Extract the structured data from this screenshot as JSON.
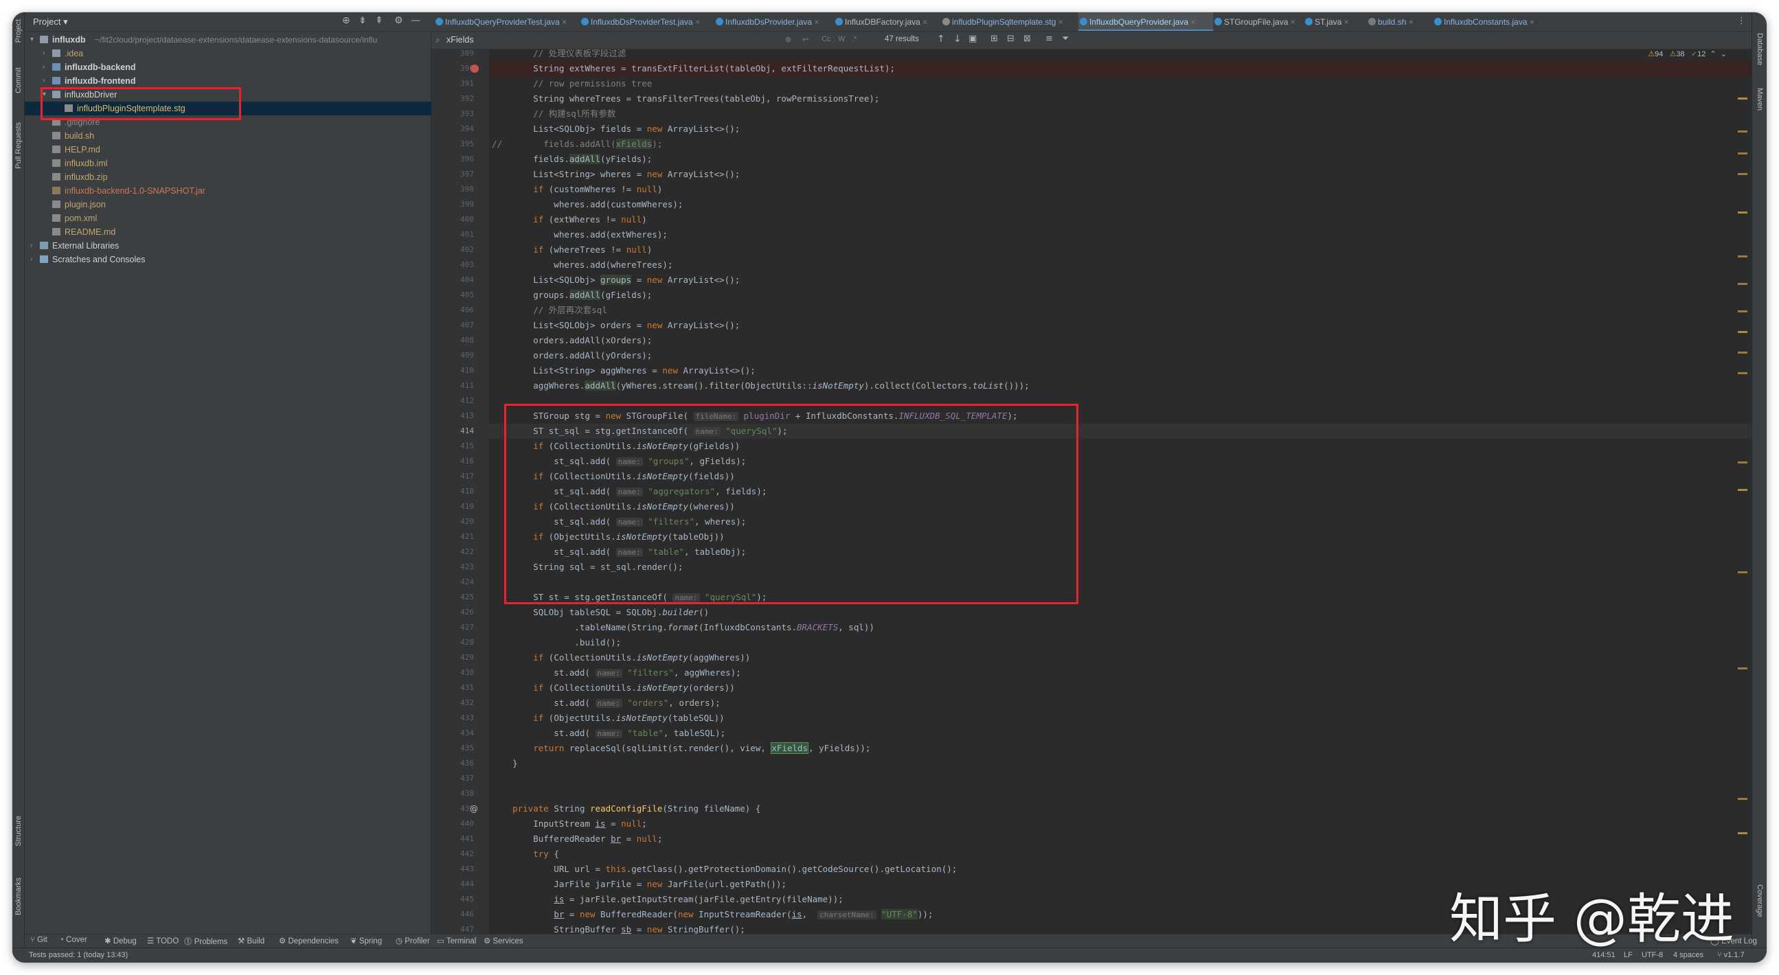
{
  "side_tools": {
    "left": [
      "Project",
      "Commit",
      "Pull Requests",
      "Structure",
      "Bookmarks"
    ],
    "right": [
      "Database",
      "Maven",
      "Coverage"
    ]
  },
  "project": {
    "title": "Project",
    "rows": [
      {
        "arrow": "▾",
        "label": "influxdb",
        "suffix": "~/fit2cloud/project/dataease-extensions/dataease-extensions-datasource/influ",
        "icon": "folder-icon",
        "color": "#d0d0d0",
        "bold": true,
        "indent": 0
      },
      {
        "arrow": "›",
        "label": ".idea",
        "icon": "folder-icon",
        "color": "#c5a66b",
        "indent": 1
      },
      {
        "arrow": "›",
        "label": "influxdb-backend",
        "icon": "module-folder-icon",
        "color": "#d0d0d0",
        "bold": true,
        "indent": 1
      },
      {
        "arrow": "›",
        "label": "influxdb-frontend",
        "icon": "module-folder-icon",
        "color": "#d0d0d0",
        "bold": true,
        "indent": 1
      },
      {
        "arrow": "▾",
        "label": "influxdbDriver",
        "icon": "folder-icon",
        "color": "#d0d0d0",
        "indent": 1
      },
      {
        "arrow": "",
        "label": "infludbPluginSqltemplate.stg",
        "icon": "file-icon",
        "color": "#d6bd6b",
        "indent": 2,
        "selected": true
      },
      {
        "arrow": "",
        "label": ".gitignore",
        "icon": "file-icon",
        "color": "#8a8a8a",
        "indent": 1
      },
      {
        "arrow": "",
        "label": "build.sh",
        "icon": "file-icon",
        "color": "#c5a66b",
        "indent": 1
      },
      {
        "arrow": "",
        "label": "HELP.md",
        "icon": "file-icon",
        "color": "#c5a66b",
        "indent": 1
      },
      {
        "arrow": "",
        "label": "influxdb.iml",
        "icon": "file-icon",
        "color": "#c5a66b",
        "indent": 1
      },
      {
        "arrow": "",
        "label": "influxdb.zip",
        "icon": "file-icon",
        "color": "#c5a66b",
        "indent": 1
      },
      {
        "arrow": "",
        "label": "influxdb-backend-1.0-SNAPSHOT.jar",
        "icon": "jar-icon",
        "color": "#d07852",
        "indent": 1
      },
      {
        "arrow": "",
        "label": "plugin.json",
        "icon": "file-icon",
        "color": "#c5a66b",
        "indent": 1
      },
      {
        "arrow": "",
        "label": "pom.xml",
        "icon": "file-icon",
        "color": "#c5a66b",
        "indent": 1
      },
      {
        "arrow": "",
        "label": "README.md",
        "icon": "file-icon",
        "color": "#c5a66b",
        "indent": 1
      },
      {
        "arrow": "›",
        "label": "External Libraries",
        "icon": "library-icon",
        "color": "#d0d0d0",
        "indent": 0
      },
      {
        "arrow": "›",
        "label": "Scratches and Consoles",
        "icon": "scratch-icon",
        "color": "#d0d0d0",
        "indent": 0
      }
    ]
  },
  "tabs": [
    {
      "label": "InfluxdbQueryProviderTest.java",
      "state": "mod"
    },
    {
      "label": "InfluxdbDsProviderTest.java",
      "state": "mod"
    },
    {
      "label": "InfluxdbDsProvider.java",
      "state": "mod"
    },
    {
      "label": "InfluxDBFactory.java",
      "state": ""
    },
    {
      "label": "infludbPluginSqltemplate.stg",
      "state": "mod"
    },
    {
      "label": "InfluxdbQueryProvider.java",
      "state": "active"
    },
    {
      "label": "STGroupFile.java",
      "state": ""
    },
    {
      "label": "ST.java",
      "state": ""
    },
    {
      "label": "build.sh",
      "state": "mod"
    },
    {
      "label": "InfluxdbConstants.java",
      "state": "mod"
    }
  ],
  "search": {
    "query": "xFields",
    "results": "47 results",
    "opts": [
      "Cc",
      "W",
      ".*"
    ]
  },
  "inspections": {
    "warnings": "94",
    "weak": "38",
    "ok": "12"
  },
  "code": [
    {
      "n": "389",
      "h": "<span class='cm'>        // 处理仪表板字段过滤</span>"
    },
    {
      "n": "390",
      "h": "        String extWheres = transExtFilterList(tableObj, extFilterRequestList);",
      "bp": true,
      "err": true
    },
    {
      "n": "391",
      "h": "<span class='cm'>        // row permissions tree</span>"
    },
    {
      "n": "392",
      "h": "        String whereTrees = transFilterTrees(tableObj, rowPermissionsTree);"
    },
    {
      "n": "393",
      "h": "<span class='cm'>        // 构建sql所有参数</span>"
    },
    {
      "n": "394",
      "h": "        List&lt;SQLObj&gt; fields = <span class='kw'>new</span> ArrayList&lt;&gt;();"
    },
    {
      "n": "395",
      "h": "<span class='cm'>//        fields.addAll(</span><span class='hl cm'>xFields</span><span class='cm'>);</span>"
    },
    {
      "n": "396",
      "h": "        fields.<span class='hl'>addAll</span>(yFields);"
    },
    {
      "n": "397",
      "h": "        List&lt;String&gt; wheres = <span class='kw'>new</span> ArrayList&lt;&gt;();"
    },
    {
      "n": "398",
      "h": "        <span class='kw'>if</span> (customWheres != <span class='kw'>null</span>)"
    },
    {
      "n": "399",
      "h": "            wheres.add(customWheres);"
    },
    {
      "n": "400",
      "h": "        <span class='kw'>if</span> (extWheres != <span class='kw'>null</span>)"
    },
    {
      "n": "401",
      "h": "            wheres.add(extWheres);"
    },
    {
      "n": "402",
      "h": "        <span class='kw'>if</span> (whereTrees != <span class='kw'>null</span>)"
    },
    {
      "n": "403",
      "h": "            wheres.add(whereTrees);"
    },
    {
      "n": "404",
      "h": "        List&lt;SQLObj&gt; <span class='hl'>groups</span> = <span class='kw'>new</span> ArrayList&lt;&gt;();"
    },
    {
      "n": "405",
      "h": "        groups.<span class='hl'>addAll</span>(gFields);"
    },
    {
      "n": "406",
      "h": "<span class='cm'>        // 外层再次套sql</span>"
    },
    {
      "n": "407",
      "h": "        List&lt;SQLObj&gt; orders = <span class='kw'>new</span> ArrayList&lt;&gt;();"
    },
    {
      "n": "408",
      "h": "        orders.addAll(xOrders);"
    },
    {
      "n": "409",
      "h": "        orders.addAll(yOrders);"
    },
    {
      "n": "410",
      "h": "        List&lt;String&gt; aggWheres = <span class='kw'>new</span> ArrayList&lt;&gt;();"
    },
    {
      "n": "411",
      "h": "        aggWheres.<span class='hl'>addAll</span>(yWheres.stream().filter(ObjectUtils::<span class='it'>isNotEmpty</span>).collect(Collectors.<span class='it'>toList</span>()));"
    },
    {
      "n": "412",
      "h": ""
    },
    {
      "n": "413",
      "h": "        STGroup stg = <span class='kw'>new</span> STGroupFile( <span class='hint'>fileName:</span> <span class='gr'>pluginDir</span> + InfluxdbConstants.<span class='cn'>INFLUXDB_SQL_TEMPLATE</span>);"
    },
    {
      "n": "414",
      "h": "        ST st_sql = stg.getInstanceOf( <span class='hint'>name:</span> <span class='st'>\"querySql\"</span>);",
      "cur": true
    },
    {
      "n": "415",
      "h": "        <span class='kw'>if</span> (CollectionUtils.<span class='it'>isNotEmpty</span>(gFields))"
    },
    {
      "n": "416",
      "h": "            st_sql.add( <span class='hint'>name:</span> <span class='st'>\"groups\"</span>, gFields);"
    },
    {
      "n": "417",
      "h": "        <span class='kw'>if</span> (CollectionUtils.<span class='it'>isNotEmpty</span>(fields))"
    },
    {
      "n": "418",
      "h": "            st_sql.add( <span class='hint'>name:</span> <span class='st'>\"aggregators\"</span>, fields);"
    },
    {
      "n": "419",
      "h": "        <span class='kw'>if</span> (CollectionUtils.<span class='it'>isNotEmpty</span>(wheres))"
    },
    {
      "n": "420",
      "h": "            st_sql.add( <span class='hint'>name:</span> <span class='st'>\"filters\"</span>, wheres);"
    },
    {
      "n": "421",
      "h": "        <span class='kw'>if</span> (ObjectUtils.<span class='it'>isNotEmpty</span>(tableObj))"
    },
    {
      "n": "422",
      "h": "            st_sql.add( <span class='hint'>name:</span> <span class='st'>\"table\"</span>, tableObj);"
    },
    {
      "n": "423",
      "h": "        String sql = st_sql.render();"
    },
    {
      "n": "424",
      "h": ""
    },
    {
      "n": "425",
      "h": "        ST st = stg.getInstanceOf( <span class='hint'>name:</span> <span class='st'>\"querySql\"</span>);"
    },
    {
      "n": "426",
      "h": "        SQLObj tableSQL = SQLObj.<span class='it'>builder</span>()"
    },
    {
      "n": "427",
      "h": "                .tableName(String.<span class='it'>format</span>(InfluxdbConstants.<span class='cn'>BRACKETS</span>, sql))"
    },
    {
      "n": "428",
      "h": "                .build();"
    },
    {
      "n": "429",
      "h": "        <span class='kw'>if</span> (CollectionUtils.<span class='it'>isNotEmpty</span>(aggWheres))"
    },
    {
      "n": "430",
      "h": "            st.add( <span class='hint'>name:</span> <span class='st'>\"filters\"</span>, aggWheres);"
    },
    {
      "n": "431",
      "h": "        <span class='kw'>if</span> (CollectionUtils.<span class='it'>isNotEmpty</span>(orders))"
    },
    {
      "n": "432",
      "h": "            st.add( <span class='hint'>name:</span> <span class='st'>\"orders\"</span>, orders);"
    },
    {
      "n": "433",
      "h": "        <span class='kw'>if</span> (ObjectUtils.<span class='it'>isNotEmpty</span>(tableSQL))"
    },
    {
      "n": "434",
      "h": "            st.add( <span class='hint'>name:</span> <span class='st'>\"table\"</span>, tableSQL);"
    },
    {
      "n": "435",
      "h": "        <span class='kw'>return</span> replaceSql(sqlLimit(st.render(), view, <span class='hm'>xFields</span>, yFields));"
    },
    {
      "n": "436",
      "h": "    }"
    },
    {
      "n": "437",
      "h": ""
    },
    {
      "n": "438",
      "h": ""
    },
    {
      "n": "439",
      "h": "    <span class='kw'>private</span> String <span class='fn'>readConfigFile</span>(String fileName) {",
      "at": true
    },
    {
      "n": "440",
      "h": "        InputStream <u>is</u> = <span class='kw'>null</span>;"
    },
    {
      "n": "441",
      "h": "        BufferedReader <u>br</u> = <span class='kw'>null</span>;"
    },
    {
      "n": "442",
      "h": "        <span class='kw'>try</span> {"
    },
    {
      "n": "443",
      "h": "            URL url = <span class='kw'>this</span>.getClass().getProtectionDomain().getCodeSource().getLocation();"
    },
    {
      "n": "444",
      "h": "            JarFile jarFile = <span class='kw'>new</span> JarFile(url.getPath());"
    },
    {
      "n": "445",
      "h": "            <u>is</u> = jarFile.getInputStream(jarFile.getEntry(fileName));"
    },
    {
      "n": "446",
      "h": "            <u>br</u> = <span class='kw'>new</span> BufferedReader(<span class='kw'>new</span> InputStreamReader(<u>is</u>,  <span class='hint'>charsetName:</span> <span class='st hl'>\"UTF-8\"</span>));"
    },
    {
      "n": "447",
      "h": "            StringBuffer <u>sb</u> = <span class='kw'>new</span> StringBuffer();"
    }
  ],
  "tool_windows": [
    "Git",
    "Cover",
    "Debug",
    "TODO",
    "Problems",
    "Build",
    "Dependencies",
    "Spring",
    "Profiler",
    "Terminal",
    "Services"
  ],
  "event_log": "Event Log",
  "status": {
    "left": "Tests passed: 1 (today 13:43)",
    "position": "414:51",
    "line_sep": "LF",
    "encoding": "UTF-8",
    "indent": "4 spaces",
    "branch": "v1.1.7"
  },
  "watermark": "知乎 @乾进"
}
